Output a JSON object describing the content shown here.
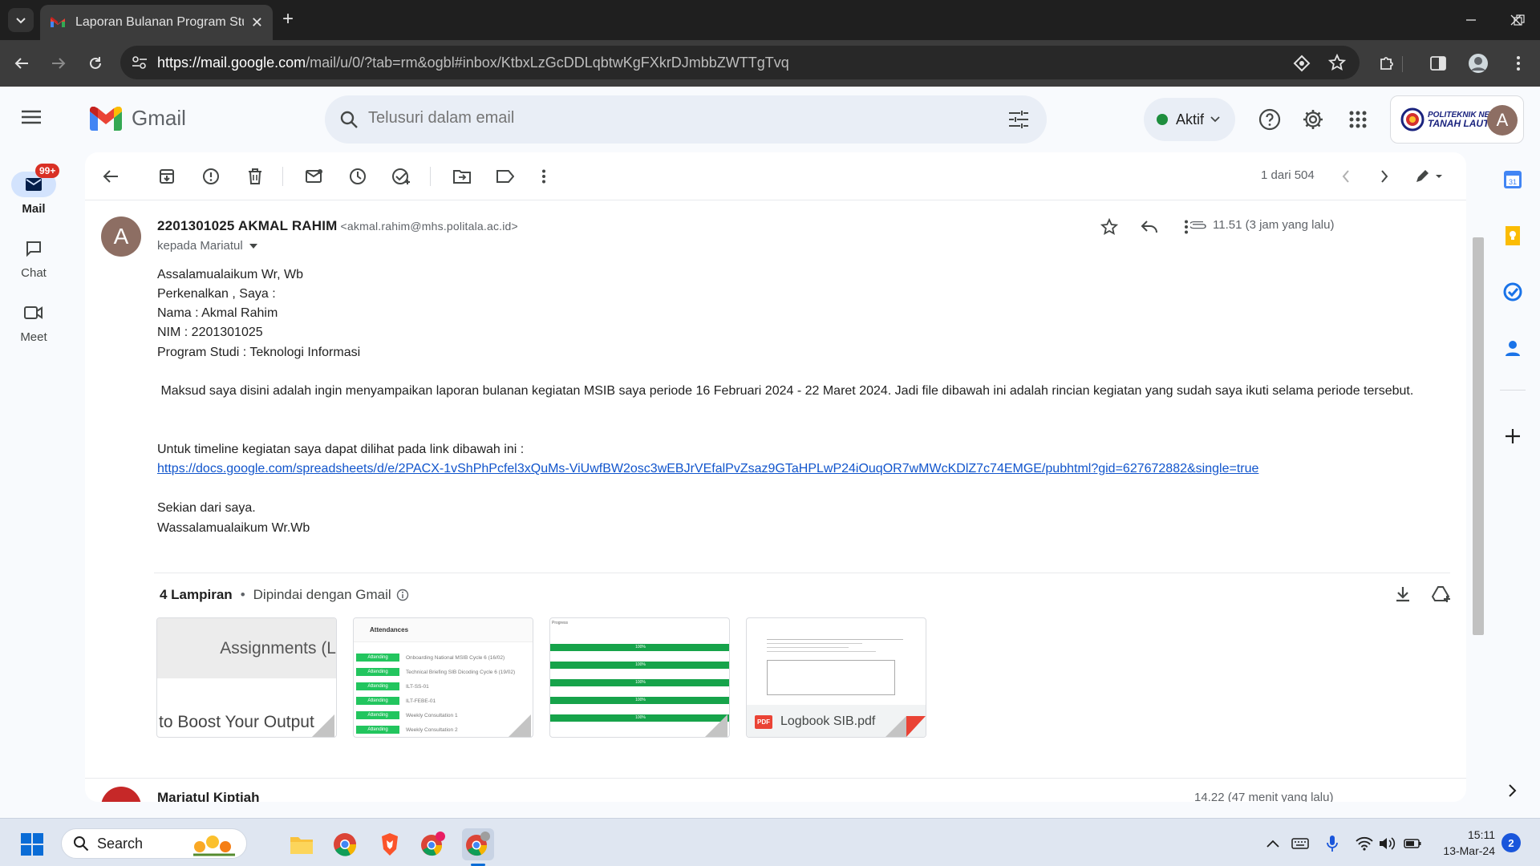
{
  "browser": {
    "tab_title": "Laporan Bulanan Program Studi",
    "url_host": "https://mail.google.com",
    "url_path": "/mail/u/0/?tab=rm&ogbl#inbox/KtbxLzGcDDLqbtwKgFXkrDJmbbZWTTgTvq"
  },
  "gmail": {
    "logo_text": "Gmail",
    "search_placeholder": "Telusuri dalam email",
    "status_label": "Aktif",
    "org_logo_text_line1": "POLITEKNIK NEGERI",
    "org_logo_text_line2": "TANAH LAUT",
    "account_initial": "A"
  },
  "nav": {
    "mail_label": "Mail",
    "mail_badge": "99+",
    "chat_label": "Chat",
    "meet_label": "Meet"
  },
  "toolbar": {
    "pager": "1 dari 504"
  },
  "message": {
    "sender_initial": "A",
    "sender_name": "2201301025 AKMAL RAHIM",
    "sender_email": "<akmal.rahim@mhs.politala.ac.id>",
    "recipient": "kepada Mariatul",
    "time": "11.51 (3 jam yang lalu)",
    "body": {
      "line1": "Assalamualaikum Wr, Wb",
      "line2": "Perkenalkan , Saya :",
      "line3": "Nama : Akmal Rahim",
      "line4": "NIM : 2201301025",
      "line5": "Program Studi : Teknologi Informasi",
      "line6": " Maksud saya disini adalah ingin menyampaikan laporan bulanan kegiatan MSIB saya periode 16 Februari 2024 - 22 Maret 2024. Jadi file dibawah ini adalah rincian kegiatan yang sudah saya ikuti selama periode tersebut.",
      "line7": "Untuk timeline kegiatan saya dapat dilihat pada link dibawah ini :",
      "link": "https://docs.google.com/spreadsheets/d/e/2PACX-1vShPhPcfel3xQuMs-ViUwfBW2osc3wEBJrVEfalPvZsaz9GTaHPLwP24iOuqOR7wMWcKDlZ7c74EMGE/pubhtml?gid=627672882&single=true",
      "line8": "Sekian dari saya.",
      "line9": "Wassalamualaikum Wr.Wb"
    },
    "attachments": {
      "count_label": "4 Lampiran",
      "scan_label": "Dipindai dengan Gmail",
      "items": [
        {
          "preview_top": "Assignments (L",
          "preview_bottom": "to Boost Your Output"
        },
        {
          "preview_title": "Attendances",
          "rows": [
            {
              "badge": "Attending",
              "text": "Onboarding National MSIB Cycle 6 (16/02)"
            },
            {
              "badge": "Attending",
              "text": "Technical Briefing SIB Dicoding Cycle 6 (19/02)"
            },
            {
              "badge": "Attending",
              "text": "ILT-SS-01"
            },
            {
              "badge": "Attending",
              "text": "ILT-FEBE-01"
            },
            {
              "badge": "Attending",
              "text": "Weekly Consultation 1"
            },
            {
              "badge": "Attending",
              "text": "Weekly Consultation 2"
            }
          ]
        },
        {
          "preview_title": "Progress",
          "bar_label": "100%"
        },
        {
          "file_name": "Logbook SIB.pdf",
          "file_type": "PDF"
        }
      ]
    }
  },
  "next_message": {
    "sender": "Mariatul Kiptiah",
    "time": "14.22 (47 menit yang lalu)"
  },
  "taskbar": {
    "search_label": "Search",
    "time": "15:11",
    "date": "13-Mar-24",
    "notification_count": "2"
  },
  "colors": {
    "gmail_red": "#ea4335",
    "status_green": "#1e8e3e",
    "attending_green": "#22c55e",
    "link_blue": "#1155cc"
  }
}
